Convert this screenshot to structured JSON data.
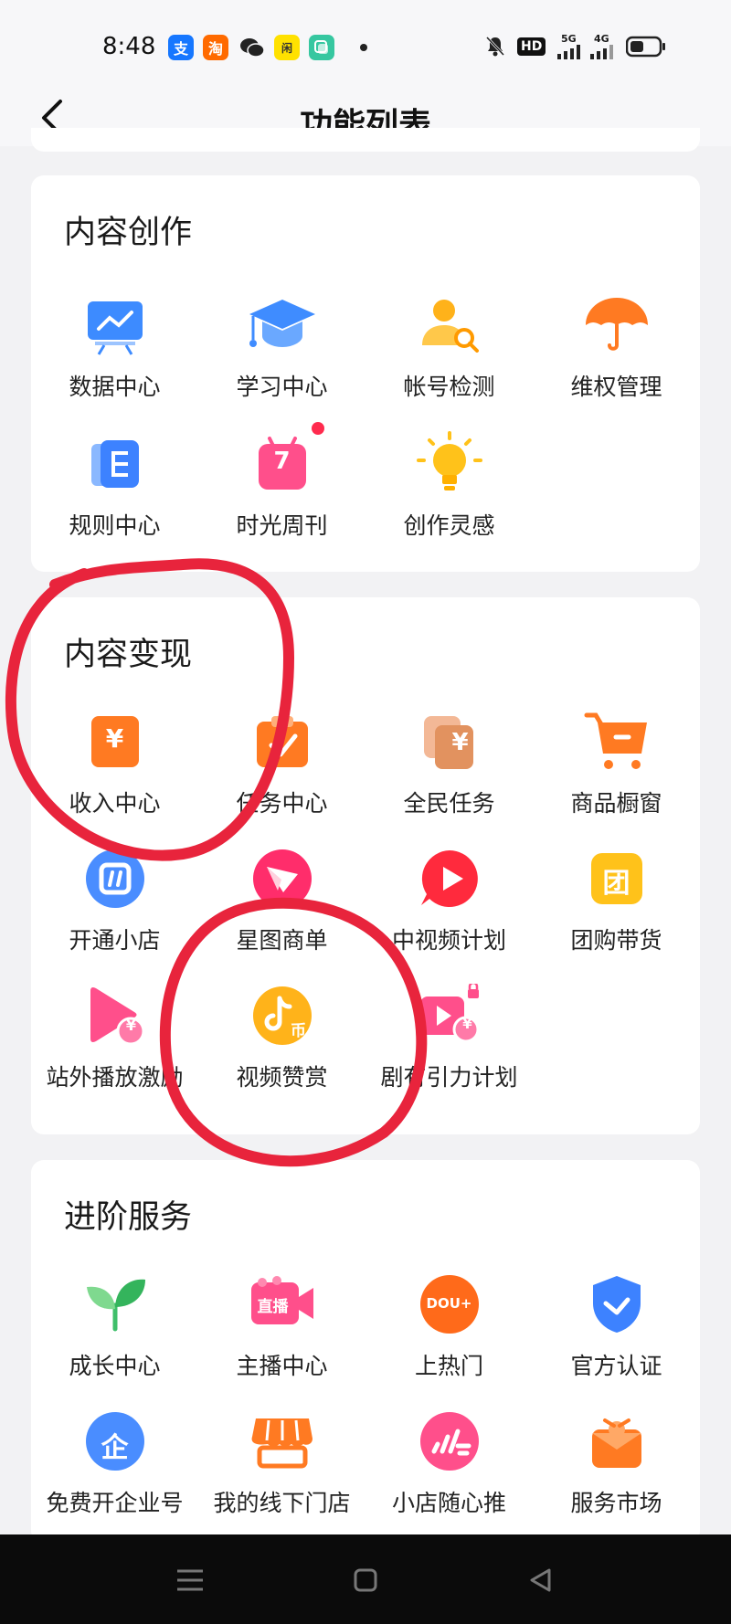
{
  "status_bar": {
    "time": "8:48",
    "app_icons": [
      {
        "name": "alipay-icon",
        "glyph": "支",
        "color": "#1677ff"
      },
      {
        "name": "taobao-icon",
        "glyph": "淘",
        "color": "#ff6a00"
      },
      {
        "name": "wechat-icon",
        "glyph": "●",
        "color": "#222222"
      },
      {
        "name": "xianyu-icon",
        "glyph": "闲",
        "color": "#ffe100"
      },
      {
        "name": "copy-app-icon",
        "glyph": "▢",
        "color": "#36c7a0"
      }
    ],
    "hd_badge": "HD",
    "net1": "5G",
    "net2": "4G"
  },
  "header": {
    "title": "功能列表"
  },
  "sections": [
    {
      "title": "内容创作",
      "items": [
        {
          "label": "数据中心",
          "icon": "data-center-icon"
        },
        {
          "label": "学习中心",
          "icon": "learning-center-icon"
        },
        {
          "label": "帐号检测",
          "icon": "account-check-icon"
        },
        {
          "label": "维权管理",
          "icon": "rights-management-icon"
        },
        {
          "label": "规则中心",
          "icon": "rules-center-icon"
        },
        {
          "label": "时光周刊",
          "icon": "time-weekly-icon",
          "badge_text": "7"
        },
        {
          "label": "创作灵感",
          "icon": "inspiration-icon"
        }
      ]
    },
    {
      "title": "内容变现",
      "items": [
        {
          "label": "收入中心",
          "icon": "income-center-icon",
          "glyph": "¥"
        },
        {
          "label": "任务中心",
          "icon": "task-center-icon"
        },
        {
          "label": "全民任务",
          "icon": "public-task-icon",
          "glyph": "¥"
        },
        {
          "label": "商品橱窗",
          "icon": "shop-window-icon"
        },
        {
          "label": "开通小店",
          "icon": "open-store-icon"
        },
        {
          "label": "星图商单",
          "icon": "star-map-icon"
        },
        {
          "label": "中视频计划",
          "icon": "mid-video-plan-icon"
        },
        {
          "label": "团购带货",
          "icon": "group-buy-icon",
          "glyph": "团"
        },
        {
          "label": "站外播放激励",
          "icon": "external-play-reward-icon",
          "glyph": "¥"
        },
        {
          "label": "视频赞赏",
          "icon": "video-reward-icon",
          "glyph": "币"
        },
        {
          "label": "剧有引力计划",
          "icon": "drama-gravity-plan-icon",
          "glyph": "¥"
        }
      ]
    },
    {
      "title": "进阶服务",
      "items": [
        {
          "label": "成长中心",
          "icon": "growth-center-icon"
        },
        {
          "label": "主播中心",
          "icon": "streamer-center-icon",
          "glyph": "直播"
        },
        {
          "label": "上热门",
          "icon": "trending-icon",
          "glyph": "DOU+"
        },
        {
          "label": "官方认证",
          "icon": "official-verify-icon"
        },
        {
          "label": "免费开企业号",
          "icon": "enterprise-account-icon",
          "glyph": "企"
        },
        {
          "label": "我的线下门店",
          "icon": "offline-store-icon"
        },
        {
          "label": "小店随心推",
          "icon": "store-promote-icon"
        },
        {
          "label": "服务市场",
          "icon": "service-market-icon"
        }
      ]
    }
  ],
  "colors": {
    "orange": "#ff7a22",
    "blue": "#3d7bff",
    "pink": "#ff3d78",
    "yellow": "#ffc21a",
    "annotation_red": "#e8243c"
  }
}
